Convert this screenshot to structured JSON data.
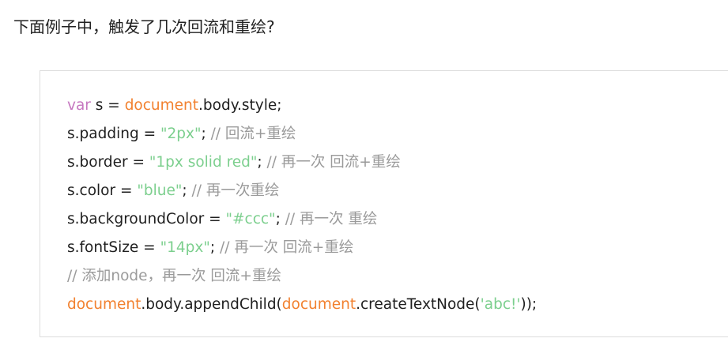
{
  "question": "下面例子中，触发了几次回流和重绘?",
  "code_lines": [
    [
      {
        "t": "var",
        "k": "kw"
      },
      {
        "t": " s = ",
        "k": "plain"
      },
      {
        "t": "document",
        "k": "obj"
      },
      {
        "t": ".body.style;",
        "k": "plain"
      }
    ],
    [
      {
        "t": "s.padding = ",
        "k": "plain"
      },
      {
        "t": "\"2px\"",
        "k": "str"
      },
      {
        "t": "; ",
        "k": "plain"
      },
      {
        "t": "// 回流+重绘",
        "k": "cmt"
      }
    ],
    [
      {
        "t": "s.border = ",
        "k": "plain"
      },
      {
        "t": "\"1px solid red\"",
        "k": "str"
      },
      {
        "t": "; ",
        "k": "plain"
      },
      {
        "t": "// 再一次 回流+重绘",
        "k": "cmt"
      }
    ],
    [
      {
        "t": "s.color = ",
        "k": "plain"
      },
      {
        "t": "\"blue\"",
        "k": "str"
      },
      {
        "t": "; ",
        "k": "plain"
      },
      {
        "t": "// 再一次重绘",
        "k": "cmt"
      }
    ],
    [
      {
        "t": "s.backgroundColor = ",
        "k": "plain"
      },
      {
        "t": "\"#ccc\"",
        "k": "str"
      },
      {
        "t": "; ",
        "k": "plain"
      },
      {
        "t": "// 再一次 重绘",
        "k": "cmt"
      }
    ],
    [
      {
        "t": "s.fontSize = ",
        "k": "plain"
      },
      {
        "t": "\"14px\"",
        "k": "str"
      },
      {
        "t": "; ",
        "k": "plain"
      },
      {
        "t": "// 再一次 回流+重绘",
        "k": "cmt"
      }
    ],
    [
      {
        "t": "// 添加node，再一次 回流+重绘",
        "k": "cmt"
      }
    ],
    [
      {
        "t": "document",
        "k": "obj"
      },
      {
        "t": ".body.appendChild(",
        "k": "plain"
      },
      {
        "t": "document",
        "k": "obj"
      },
      {
        "t": ".createTextNode(",
        "k": "plain"
      },
      {
        "t": "'abc!'",
        "k": "str"
      },
      {
        "t": "));",
        "k": "plain"
      }
    ]
  ],
  "colors": {
    "keyword": "#c678c0",
    "object": "#f2812f",
    "string": "#7ccf8e",
    "comment": "#9a9a9a",
    "text": "#1f1f1f",
    "border": "#dcdcdc"
  }
}
